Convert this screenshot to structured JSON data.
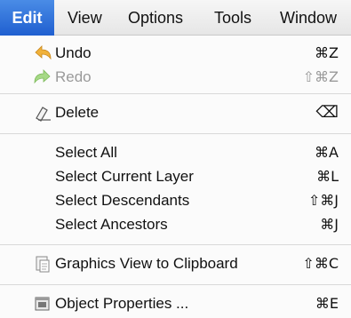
{
  "menubar": {
    "items": [
      {
        "label": "Edit"
      },
      {
        "label": "View"
      },
      {
        "label": "Options"
      },
      {
        "label": "Tools"
      },
      {
        "label": "Window"
      }
    ]
  },
  "menu": {
    "undo": {
      "label": "Undo",
      "shortcut": "⌘Z",
      "icon": "undo-arrow-icon"
    },
    "redo": {
      "label": "Redo",
      "shortcut": "⇧⌘Z",
      "icon": "redo-arrow-icon",
      "enabled": false
    },
    "delete": {
      "label": "Delete",
      "shortcut": "⌫",
      "icon": "eraser-icon"
    },
    "select_all": {
      "label": "Select All",
      "shortcut": "⌘A"
    },
    "select_current_layer": {
      "label": "Select Current Layer",
      "shortcut": "⌘L"
    },
    "select_descendants": {
      "label": "Select Descendants",
      "shortcut": "⇧⌘J"
    },
    "select_ancestors": {
      "label": "Select Ancestors",
      "shortcut": "⌘J"
    },
    "graphics_view_to_clipboard": {
      "label": "Graphics View to Clipboard",
      "shortcut": "⇧⌘C",
      "icon": "clipboard-icon"
    },
    "object_properties": {
      "label": "Object Properties ...",
      "shortcut": "⌘E",
      "icon": "properties-icon"
    }
  },
  "colors": {
    "active_menu": "#1f5fd0",
    "undo_icon": "#e8a531",
    "redo_icon": "#8fcf6a"
  }
}
